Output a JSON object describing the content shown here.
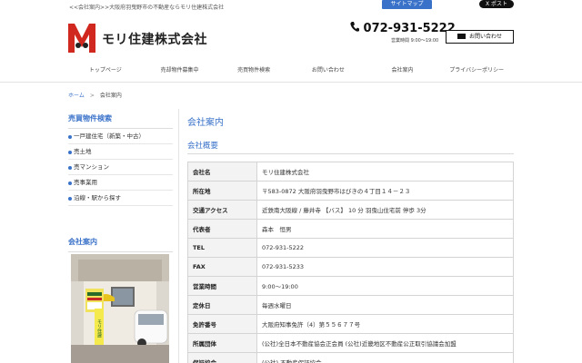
{
  "top": {
    "tagline": "<<会社案内>>大阪府羽曳野市の不動産ならモリ住建株式会社",
    "sitemap_label": "サイトマップ",
    "xpost_label": "X ポスト"
  },
  "header": {
    "company_name": "モリ住建株式会社",
    "phone": "072-931-5222",
    "hours": "営業時間 9:00～19:00",
    "contact_label": "お問い合わせ"
  },
  "nav": {
    "items": [
      {
        "label": "トップページ"
      },
      {
        "label": "売却物件募集中"
      },
      {
        "label": "売買物件検索"
      },
      {
        "label": "お問い合わせ"
      },
      {
        "label": "会社案内"
      },
      {
        "label": "プライバシーポリシー"
      }
    ]
  },
  "breadcrumb": {
    "home": "ホーム",
    "separator": ">",
    "current": "会社案内"
  },
  "sidebar": {
    "search_heading": "売買物件検索",
    "items": [
      {
        "label": "一戸建住宅（新築・中古）"
      },
      {
        "label": "売土地"
      },
      {
        "label": "売マンション"
      },
      {
        "label": "売事業用"
      },
      {
        "label": "沿線・駅から探す"
      }
    ],
    "company_heading": "会社案内",
    "sign_text": "モリ住建"
  },
  "main": {
    "title": "会社案内",
    "subtitle": "会社概要",
    "rows": [
      {
        "k": "会社名",
        "v": "モリ住建株式会社"
      },
      {
        "k": "所在地",
        "v": "〒583-0872 大阪府羽曳野市はびきの４丁目１４－２３"
      },
      {
        "k": "交通アクセス",
        "v": "近鉄南大阪線 / 藤井寺 【バス】 10 分 羽曳山住宅前 停歩 3分"
      },
      {
        "k": "代表者",
        "v": "森本　恒男"
      },
      {
        "k": "TEL",
        "v": "072-931-5222"
      },
      {
        "k": "FAX",
        "v": "072-931-5233"
      },
      {
        "k": "営業時間",
        "v": "9:00～19:00"
      },
      {
        "k": "定休日",
        "v": "毎週水曜日"
      },
      {
        "k": "免許番号",
        "v": "大阪府知事免許（4）第５５６７７号"
      },
      {
        "k": "所属団体",
        "v": "(公社)全日本不動産協会正会員 (公社)近畿地区不動産公正取引協議会加盟"
      },
      {
        "k": "保証協会",
        "v": "(公社) 不動産保証協会"
      }
    ]
  },
  "colors": {
    "accent": "#3a72c9",
    "logo_red": "#d0281e"
  }
}
